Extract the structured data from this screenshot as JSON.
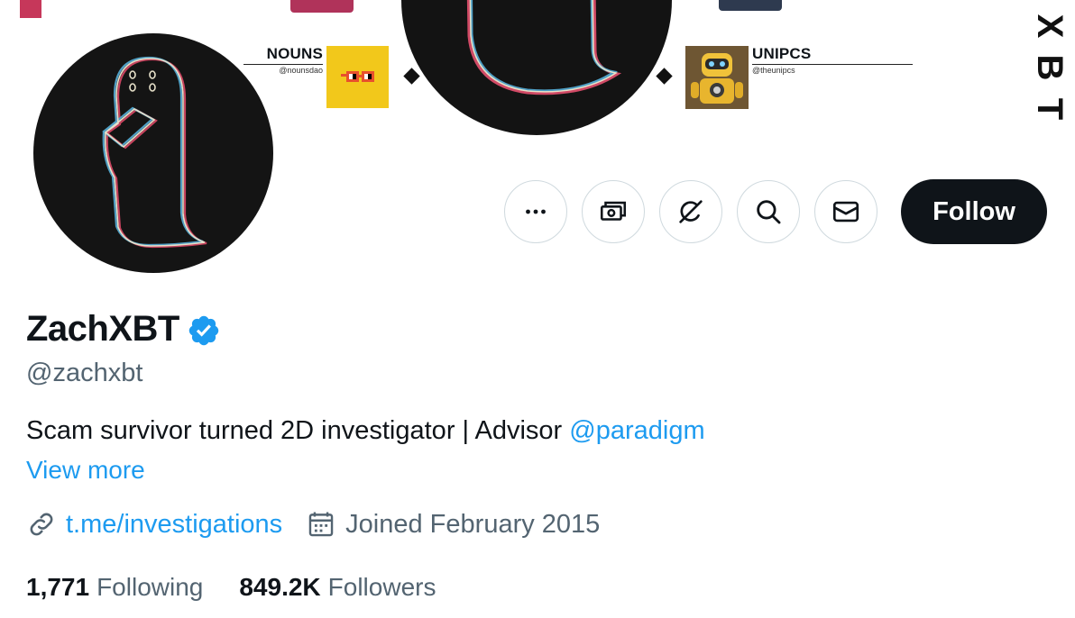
{
  "banner": {
    "left_card": {
      "title": "NOUNS",
      "handle": "@nounsdao"
    },
    "right_card": {
      "title": "UNIPCS",
      "handle": "@theunipcs"
    },
    "vertical_text": [
      "X",
      "B",
      "T"
    ]
  },
  "actions": {
    "icons": [
      "more-icon",
      "tip-icon",
      "grok-icon",
      "search-icon",
      "message-icon"
    ],
    "follow_label": "Follow"
  },
  "profile": {
    "display_name": "ZachXBT",
    "handle": "@zachxbt",
    "bio_text": "Scam survivor turned 2D investigator | Advisor ",
    "bio_mention": "@paradigm",
    "view_more": "View more",
    "website": "t.me/investigations",
    "joined": "Joined February 2015"
  },
  "stats": {
    "following_count": "1,771",
    "following_label": "Following",
    "followers_count": "849.2K",
    "followers_label": "Followers"
  },
  "colors": {
    "accent": "#1d9bf0",
    "text_primary": "#0f1419",
    "text_secondary": "#536471",
    "border": "#cfd9de",
    "nouns_bg": "#f2c81b"
  }
}
